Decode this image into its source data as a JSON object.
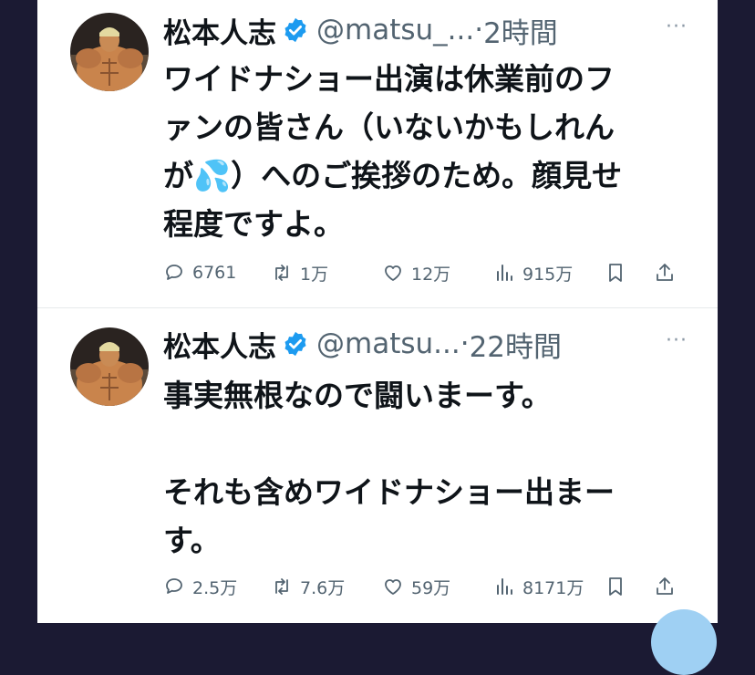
{
  "tweets": [
    {
      "name": "松本人志",
      "handle": "@matsu_...",
      "separator": "·",
      "time": "2時間",
      "more": "···",
      "text": "ワイドナショー出演は休業前のフ\nァンの皆さん（いないかもしれん\nが💦）へのご挨拶のため。顔見せ\n程度ですよ。",
      "stats": {
        "replies": "6761",
        "retweets": "1万",
        "likes": "12万",
        "views": "915万"
      }
    },
    {
      "name": "松本人志",
      "handle": "@matsu...",
      "separator": "·",
      "time": "22時間",
      "more": "···",
      "text": "事実無根なので闘いまーす。\n\nそれも含めワイドナショー出まー\nす。",
      "stats": {
        "replies": "2.5万",
        "retweets": "7.6万",
        "likes": "59万",
        "views": "8171万"
      }
    }
  ],
  "icons": {
    "avatar": "muscle-figure-avatar",
    "verified": "verified-badge-icon",
    "reply": "reply-icon",
    "retweet": "retweet-icon",
    "like": "heart-icon",
    "views": "views-icon",
    "bookmark": "bookmark-icon",
    "share": "share-icon"
  },
  "colors": {
    "verified": "#1d9bf0",
    "muted": "#536471",
    "text": "#0f1419",
    "background": "#1b1a33"
  }
}
